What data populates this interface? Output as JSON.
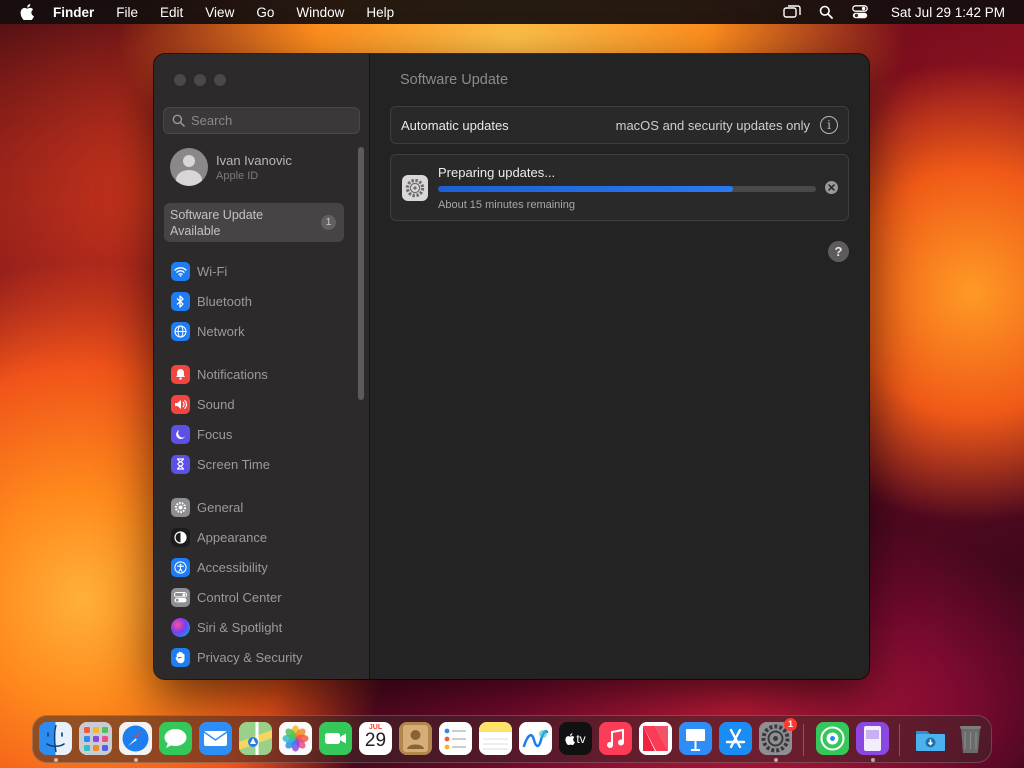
{
  "menubar": {
    "app_name": "Finder",
    "menus": [
      "File",
      "Edit",
      "View",
      "Go",
      "Window",
      "Help"
    ],
    "clock": "Sat Jul 29  1:42 PM",
    "status_icons": [
      "screen-mirroring-icon",
      "spotlight-search-icon",
      "control-center-icon"
    ]
  },
  "sidebar": {
    "search_placeholder": "Search",
    "profile": {
      "name": "Ivan Ivanovic",
      "subtitle": "Apple ID"
    },
    "update_notice": {
      "line1": "Software Update",
      "line2": "Available",
      "badge": "1"
    },
    "items": [
      {
        "label": "Wi-Fi",
        "icon": "wifi-icon",
        "color": "#1f7cf2"
      },
      {
        "label": "Bluetooth",
        "icon": "bluetooth-icon",
        "color": "#1f7cf2"
      },
      {
        "label": "Network",
        "icon": "network-globe-icon",
        "color": "#1f7cf2"
      },
      {
        "label": "Notifications",
        "icon": "notifications-icon",
        "color": "#f0463d"
      },
      {
        "label": "Sound",
        "icon": "sound-icon",
        "color": "#f0463d"
      },
      {
        "label": "Focus",
        "icon": "focus-moon-icon",
        "color": "#5d50e6"
      },
      {
        "label": "Screen Time",
        "icon": "hourglass-icon",
        "color": "#5d50e6"
      },
      {
        "label": "General",
        "icon": "gear-icon",
        "color": "#8e8e93"
      },
      {
        "label": "Appearance",
        "icon": "appearance-icon",
        "color": "#1c1c1e"
      },
      {
        "label": "Accessibility",
        "icon": "accessibility-icon",
        "color": "#1f7cf2"
      },
      {
        "label": "Control Center",
        "icon": "control-center-icon",
        "color": "#8e8e93"
      },
      {
        "label": "Siri & Spotlight",
        "icon": "siri-icon",
        "color": "#2b2b2e"
      },
      {
        "label": "Privacy & Security",
        "icon": "hand-icon",
        "color": "#1f7cf2"
      }
    ]
  },
  "main": {
    "title": "Software Update",
    "automatic_updates": {
      "label": "Automatic updates",
      "value": "macOS and security updates only",
      "info": "i"
    },
    "progress": {
      "title": "Preparing updates...",
      "fraction": 0.78,
      "remaining": "About 15 minutes remaining"
    },
    "help": "?"
  },
  "dock": {
    "apps": [
      {
        "name": "Finder",
        "icon": "finder-icon",
        "color": "#2d8cf0",
        "running": true
      },
      {
        "name": "Launchpad",
        "icon": "launchpad-icon",
        "color": "#b9bcc4"
      },
      {
        "name": "Safari",
        "icon": "safari-icon",
        "color": "#1e7ef0",
        "running": true
      },
      {
        "name": "Messages",
        "icon": "messages-icon",
        "color": "#34c759"
      },
      {
        "name": "Mail",
        "icon": "mail-icon",
        "color": "#2e8ef5"
      },
      {
        "name": "Maps",
        "icon": "maps-icon",
        "color": "#57b95b"
      },
      {
        "name": "Photos",
        "icon": "photos-icon",
        "color": "#f5f5f5"
      },
      {
        "name": "FaceTime",
        "icon": "facetime-icon",
        "color": "#34c759"
      },
      {
        "name": "Calendar",
        "icon": "calendar-icon",
        "color": "#ffffff",
        "month": "JUL",
        "day": "29"
      },
      {
        "name": "Contacts",
        "icon": "contacts-icon",
        "color": "#c59a62"
      },
      {
        "name": "Reminders",
        "icon": "reminders-icon",
        "color": "#ffffff"
      },
      {
        "name": "Notes",
        "icon": "notes-icon",
        "color": "#fde36a"
      },
      {
        "name": "Freeform",
        "icon": "freeform-icon",
        "color": "#ffffff"
      },
      {
        "name": "TV",
        "icon": "apple-tv-icon",
        "color": "#111111",
        "text": "tv"
      },
      {
        "name": "Music",
        "icon": "music-icon",
        "color": "#fa3c57"
      },
      {
        "name": "News",
        "icon": "news-icon",
        "color": "#ffffff"
      },
      {
        "name": "Keynote",
        "icon": "keynote-icon",
        "color": "#2e8ef5"
      },
      {
        "name": "App Store",
        "icon": "app-store-icon",
        "color": "#1a8cf4"
      },
      {
        "name": "System Settings",
        "icon": "system-settings-icon",
        "color": "#8e8e93",
        "badge": "1",
        "running": true
      },
      {
        "name": "Find My",
        "icon": "find-my-icon",
        "color": "#34c759"
      },
      {
        "name": "Podcasts Preview",
        "icon": "preview-icon",
        "color": "#8a48e0",
        "running": true
      },
      {
        "name": "Downloads",
        "icon": "downloads-folder-icon",
        "color": "#3aa8e8"
      },
      {
        "name": "Trash",
        "icon": "trash-icon",
        "color": "#6b6b6b"
      }
    ]
  }
}
